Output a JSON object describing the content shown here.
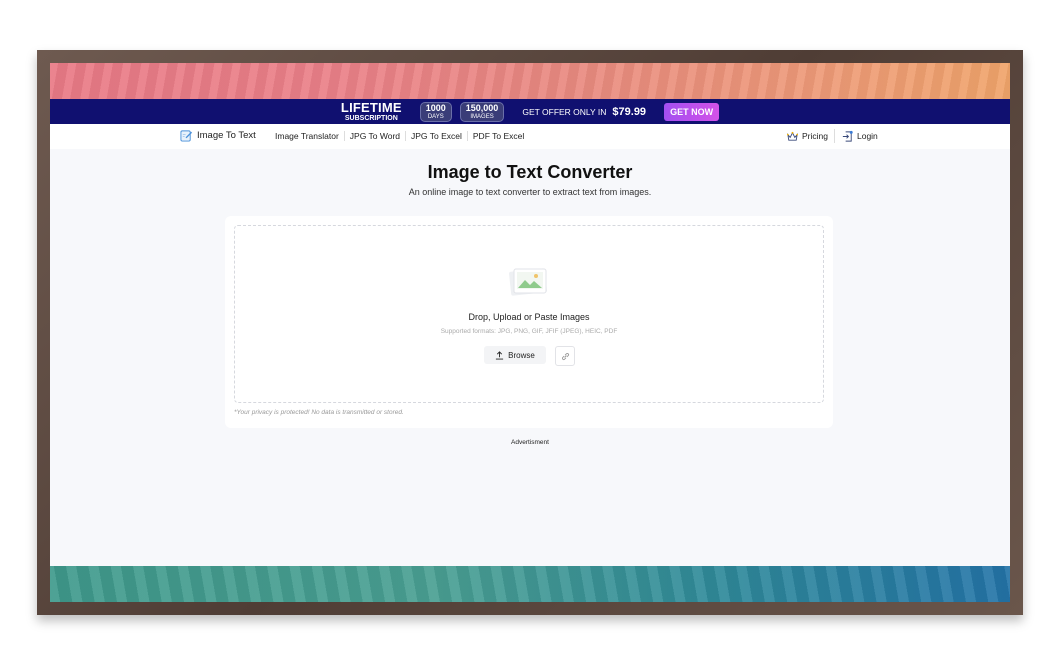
{
  "promo": {
    "lifetime": "LIFETIME",
    "subscription": "SUBSCRIPTION",
    "days_num": "1000",
    "days_unit": "DAYS",
    "images_num": "150,000",
    "images_unit": "IMAGES",
    "offer_text": "GET OFFER ONLY IN",
    "price": "$79.99",
    "cta": "GET NOW"
  },
  "nav": {
    "brand": "Image To Text",
    "links": [
      "Image Translator",
      "JPG To Word",
      "JPG To Excel",
      "PDF To Excel"
    ],
    "pricing": "Pricing",
    "login": "Login"
  },
  "hero": {
    "title": "Image to Text Converter",
    "subtitle": "An online image to text converter to extract text from images."
  },
  "upload": {
    "title": "Drop, Upload or Paste Images",
    "formats": "Supported formats: JPG, PNG, GIF, JFIF (JPEG), HEIC, PDF",
    "browse": "Browse",
    "privacy": "*Your privacy is protected! No data is transmitted or stored."
  },
  "ad_label": "Advertisment",
  "colors": {
    "promo_bg": "#101070",
    "cta_gradient": "#a34ff0",
    "page_bg": "#f7f8fb"
  },
  "icons": [
    "brand-edit-icon",
    "pricing-crown-icon",
    "login-icon",
    "image-placeholder-icon",
    "upload-icon",
    "link-icon"
  ]
}
